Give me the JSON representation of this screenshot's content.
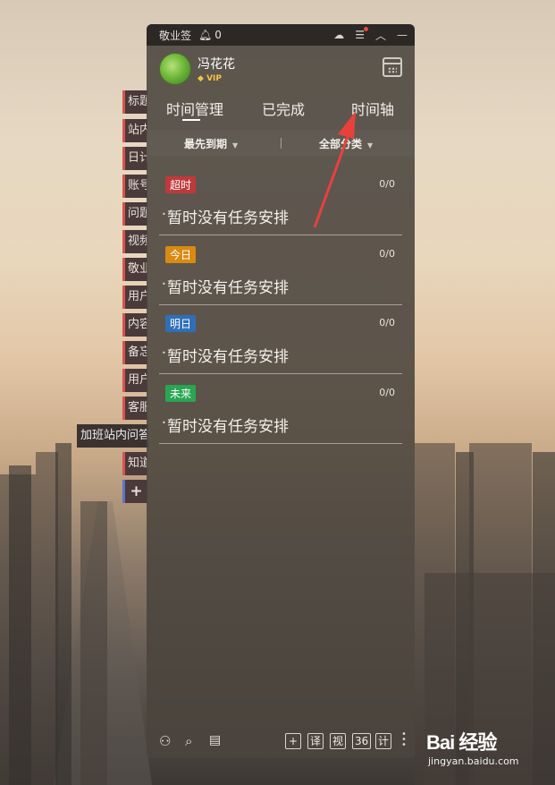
{
  "sidebar": {
    "tabs": [
      "标题",
      "站内",
      "日计",
      "账号",
      "问题",
      "视频",
      "敬业",
      "用户",
      "内容",
      "备忘",
      "用户",
      "客服",
      "知道"
    ],
    "tooltip": "加班站内问答",
    "add_label": "+"
  },
  "window": {
    "app_name": "敬业签",
    "notification_count": "0"
  },
  "profile": {
    "username": "冯花花",
    "badge": "VIP"
  },
  "tabs": [
    "时间管理",
    "已完成",
    "时间轴"
  ],
  "filters": {
    "sort": "最先到期",
    "category": "全部分类"
  },
  "sections": [
    {
      "tag": "超时",
      "tag_color": "#c0393b",
      "ratio": "0/0",
      "empty_text": "暂时没有任务安排"
    },
    {
      "tag": "今日",
      "tag_color": "#d88a12",
      "ratio": "0/0",
      "empty_text": "暂时没有任务安排"
    },
    {
      "tag": "明日",
      "tag_color": "#2f6fb8",
      "ratio": "0/0",
      "empty_text": "暂时没有任务安排"
    },
    {
      "tag": "未来",
      "tag_color": "#2aa653",
      "ratio": "0/0",
      "empty_text": "暂时没有任务安排"
    }
  ],
  "bottom_bar": {
    "buttons": [
      "+",
      "译",
      "视",
      "36",
      "计"
    ]
  },
  "watermark": {
    "brand": "Bai 经验",
    "url": "jingyan.baidu.com"
  },
  "icons": {
    "bell": "bell-icon",
    "cloud": "cloud-icon",
    "menu": "menu-icon",
    "collapse": "chevron-up-icon",
    "minimize": "minimize-icon",
    "calendar": "calendar-icon",
    "users": "users-icon",
    "search": "search-icon",
    "notes": "notes-icon"
  }
}
